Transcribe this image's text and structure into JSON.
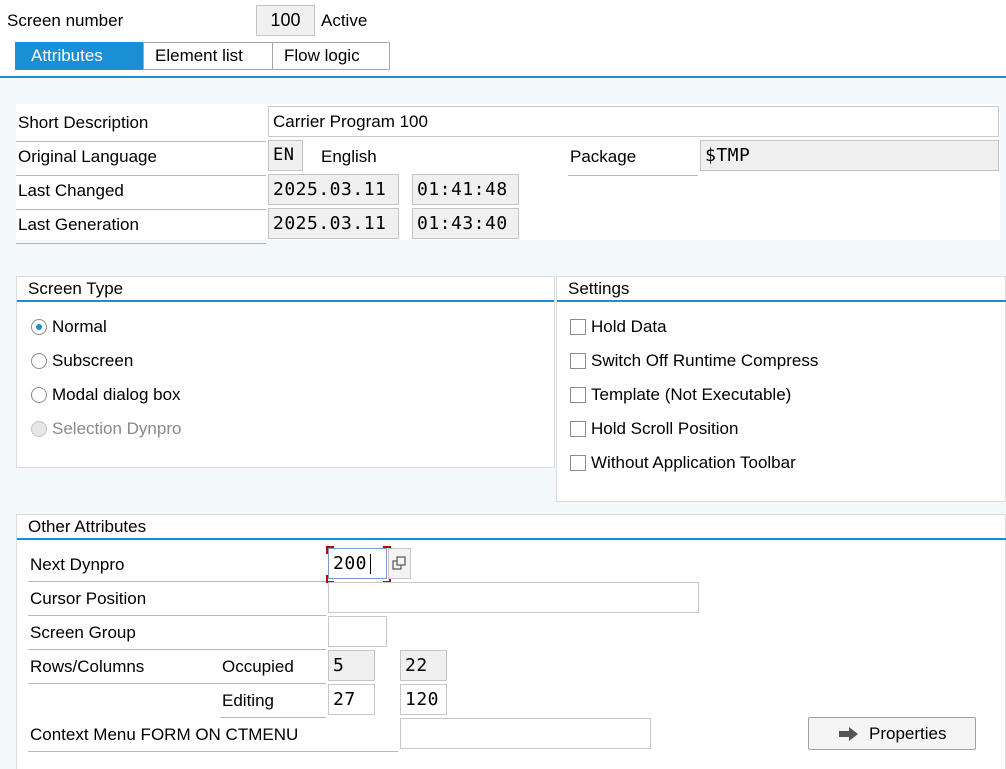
{
  "header": {
    "screen_number_label": "Screen number",
    "screen_number_value": "100",
    "status": "Active"
  },
  "tabs": [
    {
      "label": "Attributes",
      "active": true
    },
    {
      "label": "Element list",
      "active": false
    },
    {
      "label": "Flow logic",
      "active": false
    }
  ],
  "attributes": {
    "short_description_label": "Short Description",
    "short_description_value": "Carrier Program 100",
    "original_language_label": "Original Language",
    "language_code": "EN",
    "language_name": "English",
    "package_label": "Package",
    "package_value": "$TMP",
    "last_changed_label": "Last Changed",
    "last_changed_date": "2025.03.11",
    "last_changed_time": "01:41:48",
    "last_generation_label": "Last Generation",
    "last_generation_date": "2025.03.11",
    "last_generation_time": "01:43:40"
  },
  "screen_type": {
    "title": "Screen Type",
    "options": [
      {
        "label": "Normal",
        "selected": true,
        "disabled": false
      },
      {
        "label": "Subscreen",
        "selected": false,
        "disabled": false
      },
      {
        "label": "Modal dialog box",
        "selected": false,
        "disabled": false
      },
      {
        "label": "Selection Dynpro",
        "selected": false,
        "disabled": true
      }
    ]
  },
  "settings": {
    "title": "Settings",
    "options": [
      {
        "label": "Hold Data",
        "checked": false
      },
      {
        "label": "Switch Off Runtime Compress",
        "checked": false
      },
      {
        "label": "Template (Not Executable)",
        "checked": false
      },
      {
        "label": "Hold Scroll Position",
        "checked": false
      },
      {
        "label": "Without Application Toolbar",
        "checked": false
      }
    ]
  },
  "other": {
    "title": "Other Attributes",
    "next_dynpro_label": "Next Dynpro",
    "next_dynpro_value": "200",
    "cursor_position_label": "Cursor Position",
    "cursor_position_value": "",
    "screen_group_label": "Screen Group",
    "screen_group_value": "",
    "rows_columns_label": "Rows/Columns",
    "occupied_label": "Occupied",
    "occupied_rows": "5",
    "occupied_cols": "22",
    "editing_label": "Editing",
    "editing_rows": "27",
    "editing_cols": "120",
    "context_menu_label": "Context Menu FORM ON CTMENU",
    "context_menu_value": "",
    "properties_button": "Properties"
  },
  "colors": {
    "accent": "#1a8fd5",
    "focus_corner": "#c00000"
  }
}
